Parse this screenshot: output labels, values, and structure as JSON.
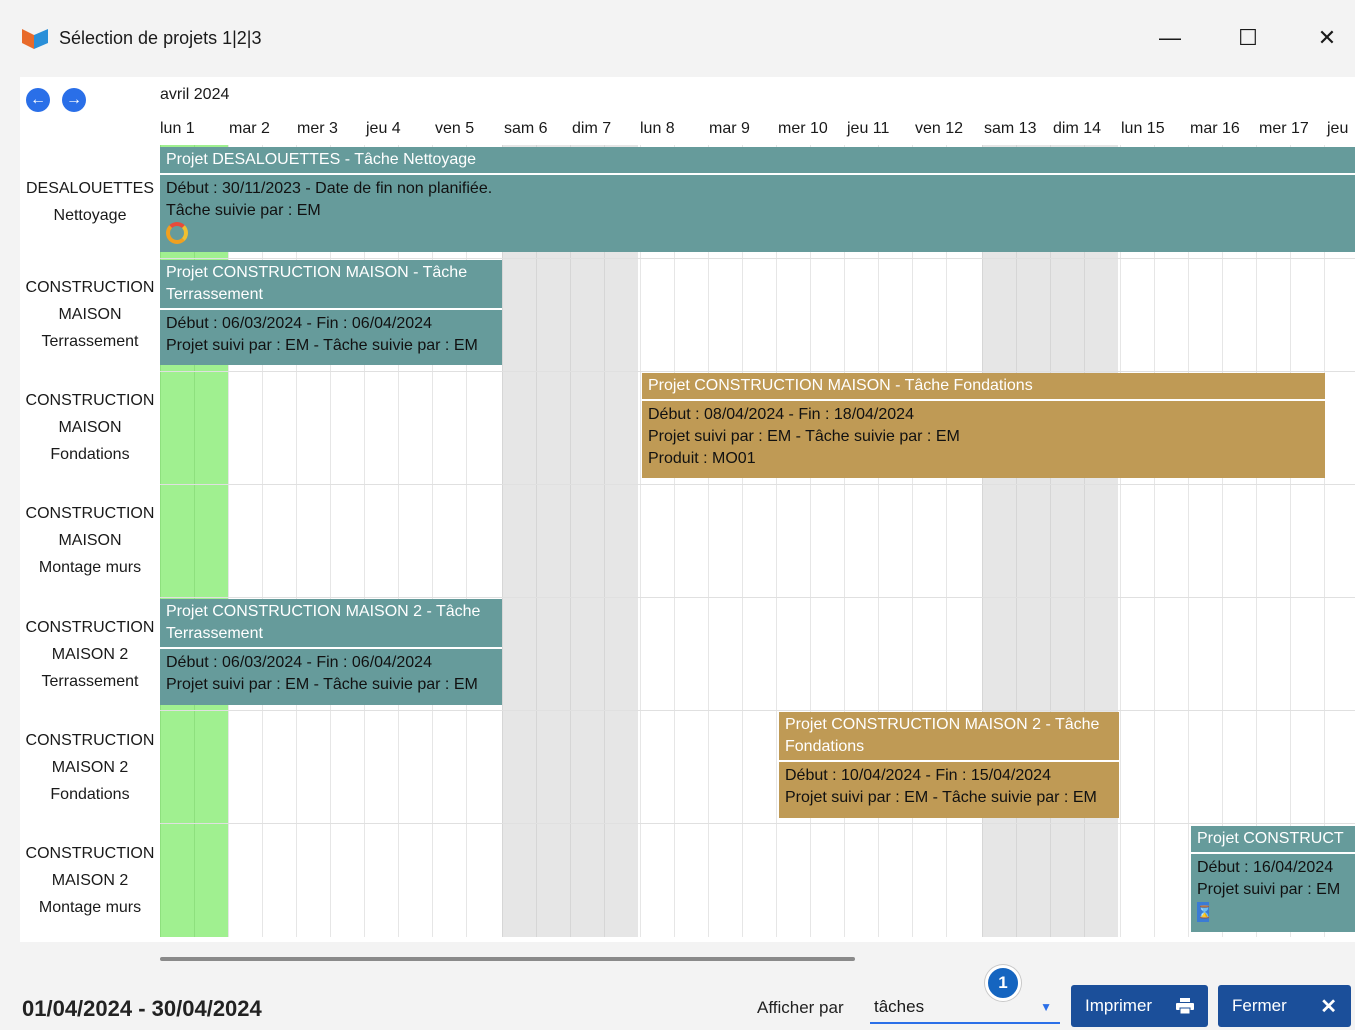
{
  "window": {
    "title": "Sélection de projets 1|2|3",
    "minimize": "—",
    "maximize": "☐",
    "close": "✕"
  },
  "nav": {
    "prev": "←",
    "next": "→"
  },
  "calendar": {
    "month": "avril 2024",
    "days": [
      "lun 1",
      "mar 2",
      "mer 3",
      "jeu 4",
      "ven 5",
      "sam 6",
      "dim 7",
      "lun 8",
      "mar 9",
      "mer 10",
      "jeu 11",
      "ven 12",
      "sam 13",
      "dim 14",
      "lun 15",
      "mar 16",
      "mer 17",
      "jeu"
    ]
  },
  "rows": [
    {
      "line1": "DESALOUETTES",
      "line2": "Nettoyage"
    },
    {
      "line1": "CONSTRUCTION",
      "line2": "MAISON",
      "line3": "Terrassement"
    },
    {
      "line1": "CONSTRUCTION",
      "line2": "MAISON",
      "line3": "Fondations"
    },
    {
      "line1": "CONSTRUCTION",
      "line2": "MAISON",
      "line3": "Montage murs"
    },
    {
      "line1": "CONSTRUCTION",
      "line2": "MAISON 2",
      "line3": "Terrassement"
    },
    {
      "line1": "CONSTRUCTION",
      "line2": "MAISON 2",
      "line3": "Fondations"
    },
    {
      "line1": "CONSTRUCTION",
      "line2": "MAISON 2",
      "line3": "Montage murs"
    }
  ],
  "tasks": {
    "t1": {
      "header": "Projet DESALOUETTES - Tâche Nettoyage",
      "l1": "Début : 30/11/2023 - Date de fin non planifiée.",
      "l2": "Tâche suivie par : EM"
    },
    "t2": {
      "header": "Projet CONSTRUCTION MAISON - Tâche Terrassement",
      "l1": "Début : 06/03/2024 - Fin : 06/04/2024",
      "l2": "Projet suivi par : EM  - Tâche suivie par : EM"
    },
    "t3": {
      "header": "Projet CONSTRUCTION MAISON - Tâche Fondations",
      "l1": "Début : 08/04/2024 - Fin : 18/04/2024",
      "l2": "Projet suivi par : EM  - Tâche suivie par : EM",
      "l3": "Produit : MO01"
    },
    "t4": {
      "header": "Projet CONSTRUCTION MAISON 2 - Tâche Terrassement",
      "l1": "Début : 06/03/2024 - Fin : 06/04/2024",
      "l2": "Projet suivi par : EM  - Tâche suivie par : EM"
    },
    "t5": {
      "header": "Projet CONSTRUCTION MAISON 2 - Tâche Fondations",
      "l1": "Début : 10/04/2024 - Fin : 15/04/2024",
      "l2": "Projet suivi par : EM  - Tâche suivie par : EM"
    },
    "t6": {
      "header": "Projet CONSTRUCT",
      "l1": "Début : 16/04/2024",
      "l2": "Projet suivi par : EM"
    }
  },
  "footer": {
    "range": "01/04/2024 - 30/04/2024",
    "afficher_label": "Afficher par",
    "afficher_value": "tâches",
    "badge": "1",
    "imprimer": "Imprimer",
    "fermer": "Fermer"
  },
  "colors": {
    "teal": "#669b9b",
    "gold": "#bf9a55",
    "today": "#a0f090",
    "weekend": "#e6e6e6",
    "button": "#1b4f9a"
  }
}
